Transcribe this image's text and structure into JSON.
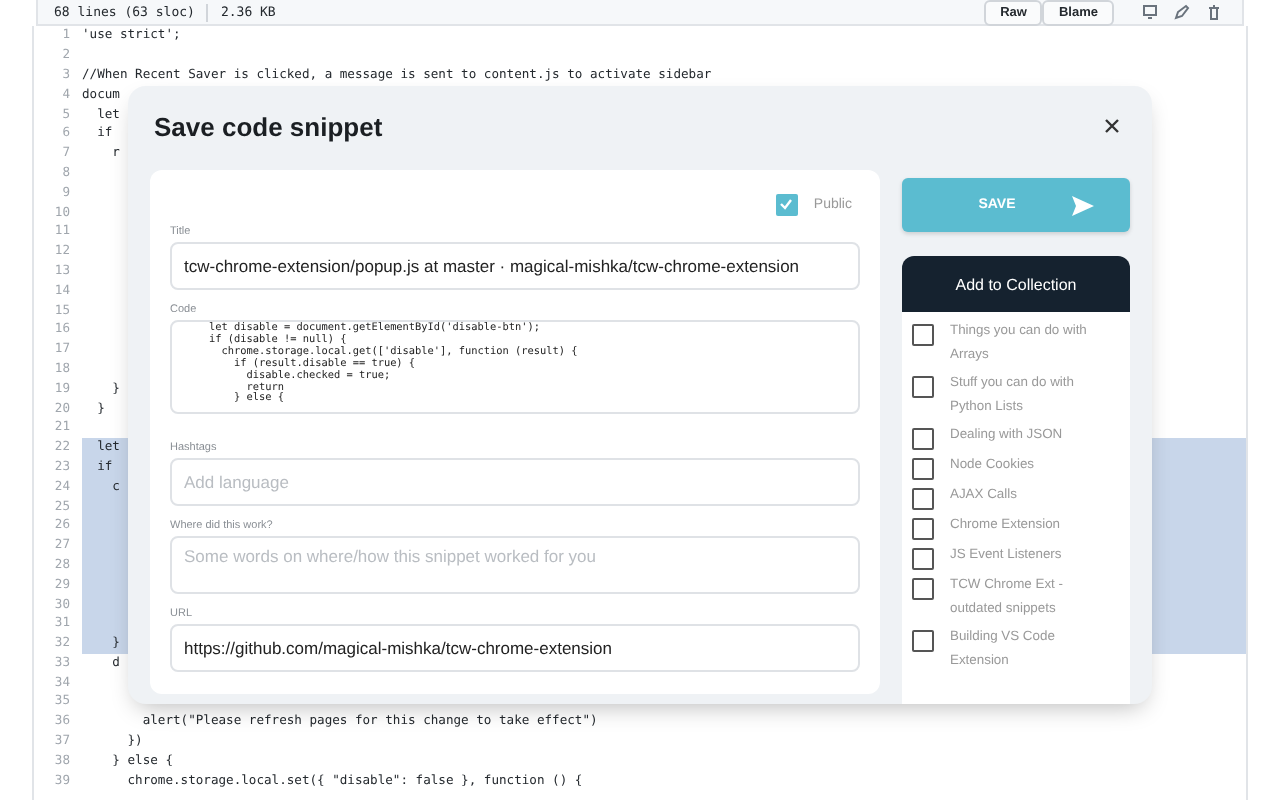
{
  "file_header": {
    "info": "68 lines (63 sloc)",
    "size": "2.36 KB",
    "buttons": [
      "Raw",
      "Blame"
    ]
  },
  "code_lines": [
    {
      "number": "1",
      "text": "'use strict';",
      "highlighted": false
    },
    {
      "number": "2",
      "highlighted": false
    },
    {
      "number": "3",
      "text": "//When Recent Saver is clicked, a message is sent to content.js to activate sidebar",
      "highlighted": false
    },
    {
      "number": "4",
      "text": "docum",
      "highlighted": false
    },
    {
      "number": "5",
      "text": "  let",
      "highlighted": false
    },
    {
      "number": "6",
      "text": "  if",
      "highlighted": false
    },
    {
      "number": "7",
      "text": "    r",
      "highlighted": false
    },
    {
      "number": "8",
      "highlighted": false
    },
    {
      "number": "9",
      "highlighted": false
    },
    {
      "number": "10",
      "highlighted": false
    },
    {
      "number": "11",
      "highlighted": false
    },
    {
      "number": "12",
      "highlighted": false
    },
    {
      "number": "13",
      "highlighted": false
    },
    {
      "number": "14",
      "highlighted": false
    },
    {
      "number": "15",
      "highlighted": false
    },
    {
      "number": "16",
      "highlighted": false
    },
    {
      "number": "17",
      "highlighted": false
    },
    {
      "number": "18",
      "highlighted": false
    },
    {
      "number": "19",
      "text": "    }",
      "highlighted": false
    },
    {
      "number": "20",
      "text": "  }",
      "highlighted": false
    },
    {
      "number": "21",
      "highlighted": false
    },
    {
      "number": "22",
      "text": "  let",
      "highlighted": true
    },
    {
      "number": "23",
      "text": "  if",
      "highlighted": true
    },
    {
      "number": "24",
      "text": "    c",
      "highlighted": true
    },
    {
      "number": "25",
      "highlighted": true
    },
    {
      "number": "26",
      "highlighted": true
    },
    {
      "number": "27",
      "highlighted": true
    },
    {
      "number": "28",
      "highlighted": true
    },
    {
      "number": "29",
      "highlighted": true
    },
    {
      "number": "30",
      "highlighted": true
    },
    {
      "number": "31",
      "highlighted": true
    },
    {
      "number": "32",
      "text": "    }",
      "highlighted": true
    },
    {
      "number": "33",
      "text": "    d",
      "highlighted": false
    },
    {
      "number": "34",
      "highlighted": false
    },
    {
      "number": "35",
      "highlighted": false
    },
    {
      "number": "36",
      "text": "        alert(\"Please refresh pages for this change to take effect\")",
      "highlighted": false
    },
    {
      "number": "37",
      "text": "      })",
      "highlighted": false
    },
    {
      "number": "38",
      "text": "    } else {",
      "highlighted": false
    },
    {
      "number": "39",
      "text": "      chrome.storage.local.set({ \"disable\": false }, function () {",
      "highlighted": false
    }
  ],
  "dialog": {
    "title": "Save code snippet",
    "public": {
      "label": "Public",
      "checked": true
    },
    "fields": [
      {
        "kind": "input",
        "label": "Title",
        "value": "tcw-chrome-extension/popup.js at master · magical-mishka/tcw-chrome-extension"
      },
      {
        "kind": "code",
        "label": "Code",
        "value": "    let disable = document.getElementById('disable-btn');\n    if (disable != null) {\n      chrome.storage.local.get(['disable'], function (result) {\n        if (result.disable == true) {\n          disable.checked = true;\n          return\n        } else {"
      },
      {
        "kind": "input",
        "label": "Hashtags",
        "placeholder": "Add language"
      },
      {
        "kind": "textarea",
        "label": "Where did this work?",
        "placeholder": "Some words on where/how this snippet worked for you"
      },
      {
        "kind": "input",
        "label": "URL",
        "value": "https://github.com/magical-mishka/tcw-chrome-extension"
      }
    ],
    "save_button": "SAVE",
    "collection_title": "Add to Collection",
    "collections": [
      {
        "label": "Things you can do with Arrays",
        "checked": false
      },
      {
        "label": "Stuff you can do with Python Lists",
        "checked": false
      },
      {
        "label": "Dealing with JSON",
        "checked": false
      },
      {
        "label": "Node Cookies",
        "checked": false
      },
      {
        "label": "AJAX Calls",
        "checked": false
      },
      {
        "label": "Chrome Extension",
        "checked": false
      },
      {
        "label": "JS Event Listeners",
        "checked": false
      },
      {
        "label": "TCW Chrome Ext - outdated snippets",
        "checked": false
      },
      {
        "label": "Building VS Code Extension",
        "checked": false
      }
    ]
  }
}
